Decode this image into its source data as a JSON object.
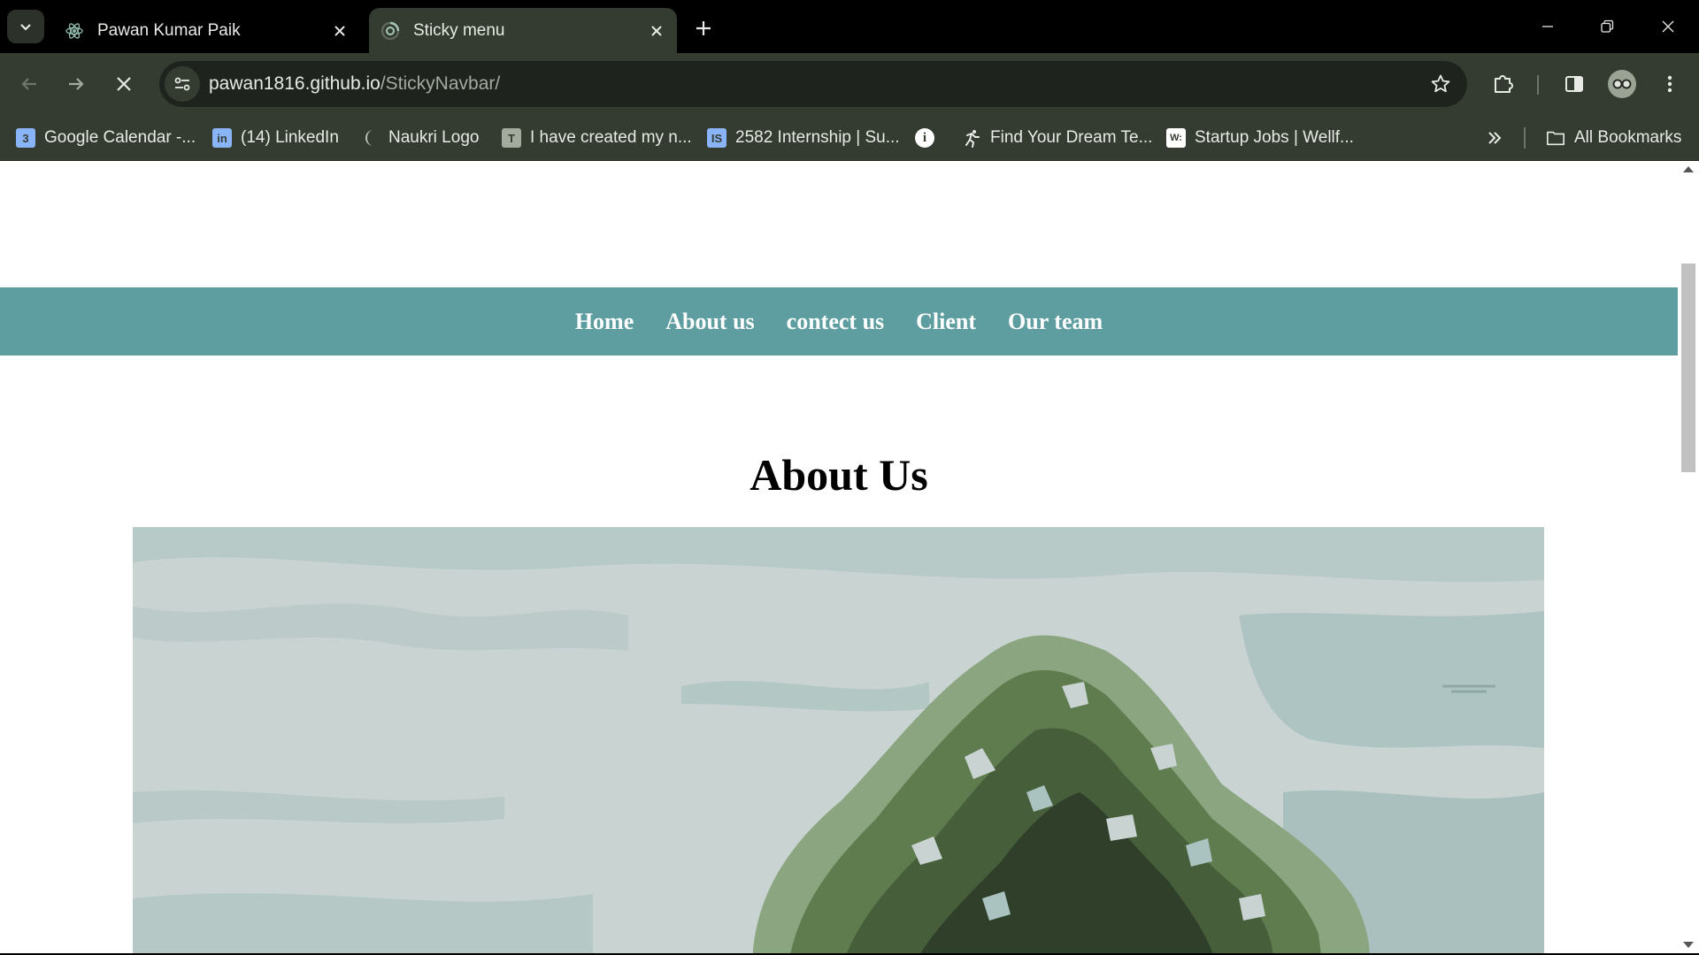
{
  "tabs": [
    {
      "title": "Pawan Kumar Paik",
      "active": false,
      "icon": "react-atom-icon"
    },
    {
      "title": "Sticky menu",
      "active": true,
      "icon": "loading-spinner-icon"
    }
  ],
  "toolbar": {
    "url_host": "pawan1816.github.io",
    "url_path": "/StickyNavbar/"
  },
  "bookmarks": [
    {
      "label": "Google Calendar -...",
      "icon": "calendar-icon",
      "icon_text": "3",
      "color": "#8ab4f8"
    },
    {
      "label": "(14) LinkedIn",
      "icon": "linkedin-icon",
      "icon_text": "in",
      "color": "#8ab4f8"
    },
    {
      "label": "Naukri Logo",
      "icon": "moon-icon",
      "icon_text": "",
      "color": "#c0c4be"
    },
    {
      "label": "I have created my n...",
      "icon": "tg-icon",
      "icon_text": "T",
      "color": "#a3ab9f"
    },
    {
      "label": "2582 Internship | Su...",
      "icon": "is-icon",
      "icon_text": "IS",
      "color": "#8ab4f8"
    },
    {
      "label": "",
      "icon": "info-icon",
      "icon_text": "i",
      "color": "#ffffff"
    },
    {
      "label": "Find Your Dream Te...",
      "icon": "runner-icon",
      "icon_text": "",
      "color": "#e8eae6"
    },
    {
      "label": "Startup Jobs | Wellf...",
      "icon": "wellfound-icon",
      "icon_text": "W:",
      "color": "#ffffff"
    }
  ],
  "all_bookmarks_label": "All Bookmarks",
  "page": {
    "nav": [
      "Home",
      "About us",
      "contect us",
      "Client",
      "Our team"
    ],
    "heading": "About Us",
    "nav_color": "#5f9ea0"
  }
}
